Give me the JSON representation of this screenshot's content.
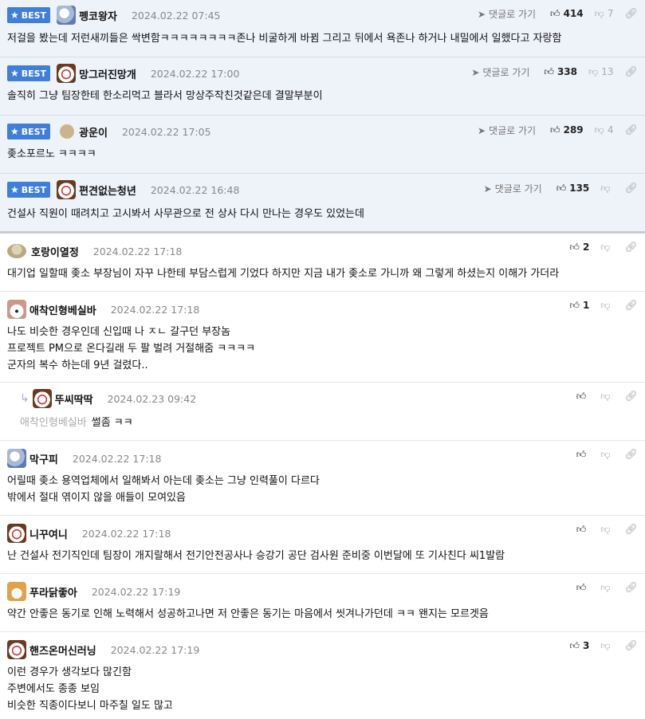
{
  "ui": {
    "best_label": "BEST",
    "goto_label": "댓글로 가기",
    "reply_icon": "reply-arrow-icon",
    "share_icon": "link-icon"
  },
  "best": [
    {
      "nick": "펭코왕자",
      "date": "2024.02.22 07:45",
      "up": "414",
      "down": "7",
      "text": "저걸을 봤는데 저런새끼들은 싹변함ㅋㅋㅋㅋㅋㅋㅋㅋ존나 비굴하게 바뀜 그리고 뒤에서 욕존나 하거나 내밀에서 일했다고 자랑함"
    },
    {
      "nick": "망그러진망개",
      "date": "2024.02.22 17:00",
      "up": "338",
      "down": "13",
      "text": "솔직히 그냥 팀장한테 한소리먹고 블라서 망상주작친것같은데 결말부분이"
    },
    {
      "nick": "광운이",
      "date": "2024.02.22 17:05",
      "up": "289",
      "down": "4",
      "text": "좆소포르노 ㅋㅋㅋㅋ"
    },
    {
      "nick": "편견없는청년",
      "date": "2024.02.22 16:48",
      "up": "135",
      "down": "",
      "text": "건설사 직원이 때려치고 고시봐서 사무관으로 전 상사 다시 만나는 경우도 있었는데"
    }
  ],
  "comments": [
    {
      "nick": "호랑이열정",
      "date": "2024.02.22 17:18",
      "up": "2",
      "lines": [
        "대기업 일할때 좆소 부장님이 자꾸 나한테 부담스럽게 기었다 하지만 지금 내가 좆소로 가니까 왜 그렇게 하셨는지 이해가 가더라"
      ]
    },
    {
      "nick": "애착인형베실바",
      "date": "2024.02.22 17:18",
      "up": "1",
      "lines": [
        "나도 비슷한 경우인데 신입때 나 ㅈㄴ 갈구던 부장놈",
        "프로젝트 PM으로 온다길래 두 팔 벌려 거절해줌 ㅋㅋㅋㅋ",
        "군자의 복수 하는데 9년 걸렸다.."
      ]
    },
    {
      "nick": "뚜씨딱딱",
      "date": "2024.02.23 09:42",
      "up": "",
      "mention": "애착인형베실바",
      "lines": [
        "썰좀 ㅋㅋ"
      ]
    },
    {
      "nick": "막구피",
      "date": "2024.02.22 17:18",
      "up": "",
      "lines": [
        "어릴때 좆소 용역업체에서 일해봐서 아는데 좆소는 그냥 인력풀이 다르다",
        "밖에서 절대 엮이지 않을 애들이 모여있음"
      ]
    },
    {
      "nick": "니꾸여니",
      "date": "2024.02.22 17:18",
      "up": "",
      "lines": [
        "난 건설사 전기직인데 팀장이 개지랄해서 전기안전공사나 승강기 공단 검사원 준비중 이번달에 또 기사친다 씨1발람"
      ]
    },
    {
      "nick": "푸라닭좋아",
      "date": "2024.02.22 17:19",
      "up": "",
      "lines": [
        "약간 안좋은 동기로 인해 노력해서 성공하고나면 저 안좋은 동기는 마음에서 씻겨나가던데 ㅋㅋ 왠지는 모르겟음"
      ]
    },
    {
      "nick": "핸즈온머신러닝",
      "date": "2024.02.22 17:19",
      "up": "3",
      "lines": [
        "이런 경우가 생각보다 많긴함",
        "주변에서도 종종 보임",
        "비슷한 직종이다보니 마주칠 일도 많고"
      ]
    }
  ]
}
